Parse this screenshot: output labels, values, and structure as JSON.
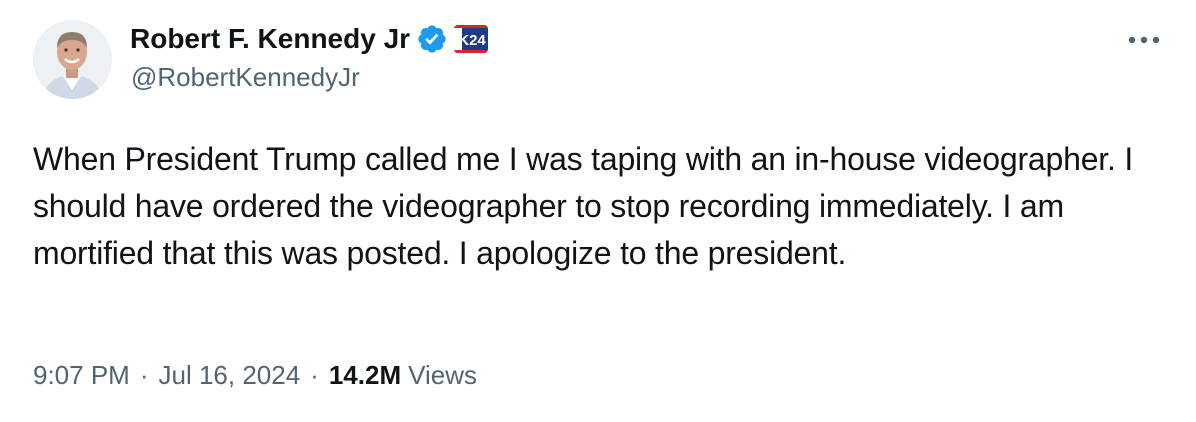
{
  "author": {
    "display_name": "Robert F. Kennedy Jr",
    "handle": "@RobertKennedyJr",
    "verified_icon": "verified-check-icon",
    "affiliate_badge_text": "K24",
    "avatar_icon": "user-avatar-photo"
  },
  "more_icon": "more-horizontal-icon",
  "tweet": {
    "text": "When President Trump called me I was taping with an in-house videographer. I should have ordered the videographer to stop recording immediately. I am mortified that this was posted. I apologize to the president."
  },
  "meta": {
    "time": "9:07 PM",
    "separator": "·",
    "date": "Jul 16, 2024",
    "views_count": "14.2M",
    "views_label": "Views"
  },
  "colors": {
    "text_primary": "#0f1419",
    "text_secondary": "#536471",
    "verified_blue": "#1d9bf0",
    "badge_blue": "#1f3a8a",
    "badge_red": "#d62828",
    "background": "#ffffff"
  }
}
